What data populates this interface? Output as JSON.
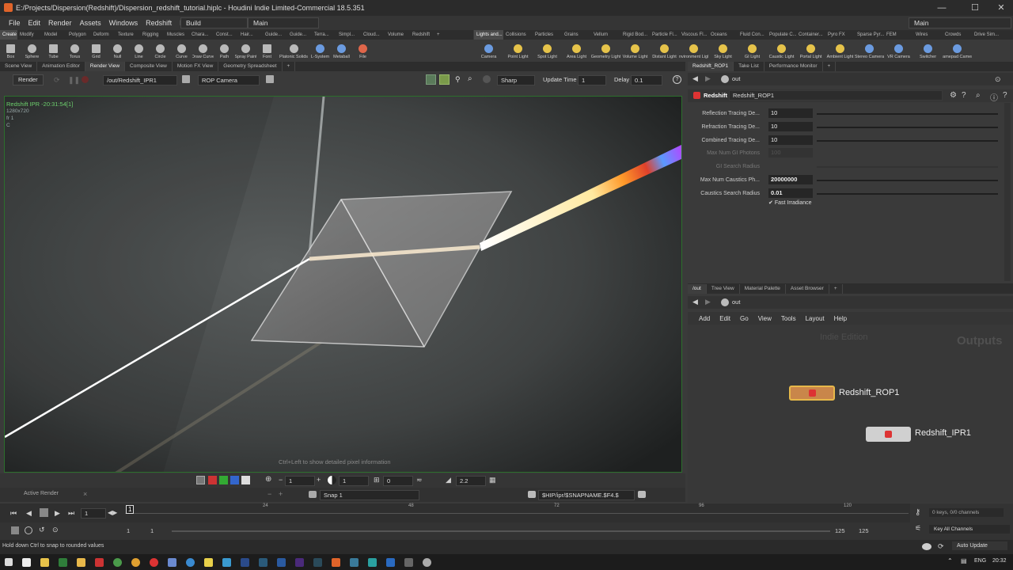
{
  "window": {
    "title": "E:/Projects/Dispersion(Redshift)/Dispersion_redshift_tutorial.hiplc - Houdini Indie Limited-Commercial 18.5.351",
    "minimize": "—",
    "maximize": "☐",
    "close": "✕"
  },
  "menu": [
    "File",
    "Edit",
    "Render",
    "Assets",
    "Windows",
    "Redshift",
    "Help"
  ],
  "desktop_left": "Build",
  "desktop_right": "Main",
  "desktop_far": "Main",
  "shelf_tabs_left": [
    "Create",
    "Modify",
    "Model",
    "Polygon",
    "Deform",
    "Texture",
    "Rigging",
    "Muscles",
    "Chara...",
    "Const...",
    "Hair...",
    "Guide...",
    "Guide...",
    "Terra...",
    "Simpl...",
    "Cloud...",
    "Volume",
    "Redshift"
  ],
  "shelf_tabs_right": [
    "Lights and...",
    "Collisions",
    "Particles",
    "Grains",
    "Vellum",
    "Rigid Bod...",
    "Particle Fl...",
    "Viscous Fl...",
    "Oceans",
    "Fluid Con...",
    "Populate C...",
    "Container...",
    "Pyro FX",
    "Sparse Pyr...",
    "FEM",
    "Wires",
    "Crowds",
    "Drive Sim..."
  ],
  "tools_left": [
    "Box",
    "Sphere",
    "Tube",
    "Torus",
    "Grid",
    "Null",
    "Line",
    "Circle",
    "Curve",
    "Draw Curve",
    "Path",
    "Spray Paint",
    "Font",
    "Platonic Solids",
    "L-System",
    "Metaball",
    "File"
  ],
  "tools_right": [
    "Camera",
    "Point Light",
    "Spot Light",
    "Area Light",
    "Geometry Light",
    "Volume Light",
    "Distant Light",
    "Environment Light",
    "Sky Light",
    "GI Light",
    "Caustic Light",
    "Portal Light",
    "Ambient Light",
    "Stereo Camera",
    "VR Camera",
    "Switcher",
    "Gamepad Camera"
  ],
  "pane_tabs_left": [
    "Scene View",
    "Animation Editor",
    "Render View",
    "Composite View",
    "Motion FX View",
    "Geometry Spreadsheet"
  ],
  "render_toolbar": {
    "render": "Render",
    "rop_path": "/out/Redshift_IPR1",
    "camera": "ROP Camera",
    "sharp": "Sharp",
    "update_time_label": "Update Time",
    "update_time": "1",
    "delay_label": "Delay",
    "delay": "0.1"
  },
  "viewport": {
    "ipr_label": "Redshift IPR -20:31:54[1]",
    "resolution": "1280x720",
    "frame": "fr 1",
    "channel": "C",
    "hint": "Ctrl+Left to show detailed pixel information"
  },
  "viewport_bottom": {
    "val1": "1",
    "val2": "1",
    "val3": "0",
    "gamma": "2.2"
  },
  "snap_bar": {
    "active_render": "Active Render",
    "snap": "Snap 1",
    "path": "$HIP/ipr/$SNAPNAME.$F4.$"
  },
  "params_tabs": [
    "Redshift_ROP1",
    "Take List",
    "Performance Monitor"
  ],
  "params_path": "out",
  "params_head": {
    "type": "Redshift",
    "name": "Redshift_ROP1"
  },
  "params": [
    {
      "label": "Reflection Tracing De...",
      "value": "10",
      "fill": 1.0
    },
    {
      "label": "Refraction Tracing De...",
      "value": "10",
      "fill": 1.0
    },
    {
      "label": "Combined Tracing De...",
      "value": "10",
      "fill": 1.0
    },
    {
      "label": "Max Num GI Photons",
      "value": "100",
      "disabled": true
    },
    {
      "label": "GI Search Radius",
      "value": "",
      "disabled": true
    },
    {
      "label": "Max Num Caustics Ph...",
      "value": "20000000",
      "fill": 0.0
    },
    {
      "label": "Caustics Search Radius",
      "value": "0.01",
      "fill": 0.0
    }
  ],
  "fast_irradiance": "Fast Irradiance",
  "net_tabs": [
    "/out",
    "Tree View",
    "Material Palette",
    "Asset Browser"
  ],
  "net_path": "out",
  "net_menu": [
    "Add",
    "Edit",
    "Go",
    "View",
    "Tools",
    "Layout",
    "Help"
  ],
  "network": {
    "watermark": "Indie Edition",
    "context": "Outputs",
    "nodes": [
      "Redshift_ROP1",
      "Redshift_IPR1"
    ]
  },
  "timeline": {
    "ticks": [
      "24",
      "48",
      "72",
      "96",
      "120"
    ],
    "frame": "1",
    "current": "1",
    "start": "1",
    "start2": "1",
    "end": "125",
    "end2": "125"
  },
  "tl_right": {
    "keys": "0 keys, 0/0 channels",
    "key_all": "Key All Channels",
    "auto_update": "Auto Update"
  },
  "status": "Hold down Ctrl to snap to rounded values",
  "taskbar": {
    "lang": "ENG",
    "time": "20:32"
  },
  "colors": {
    "ipr_green": "#6dd06d",
    "selected_node": "#e6b84a",
    "accent_blue": "#2e6fa8"
  }
}
